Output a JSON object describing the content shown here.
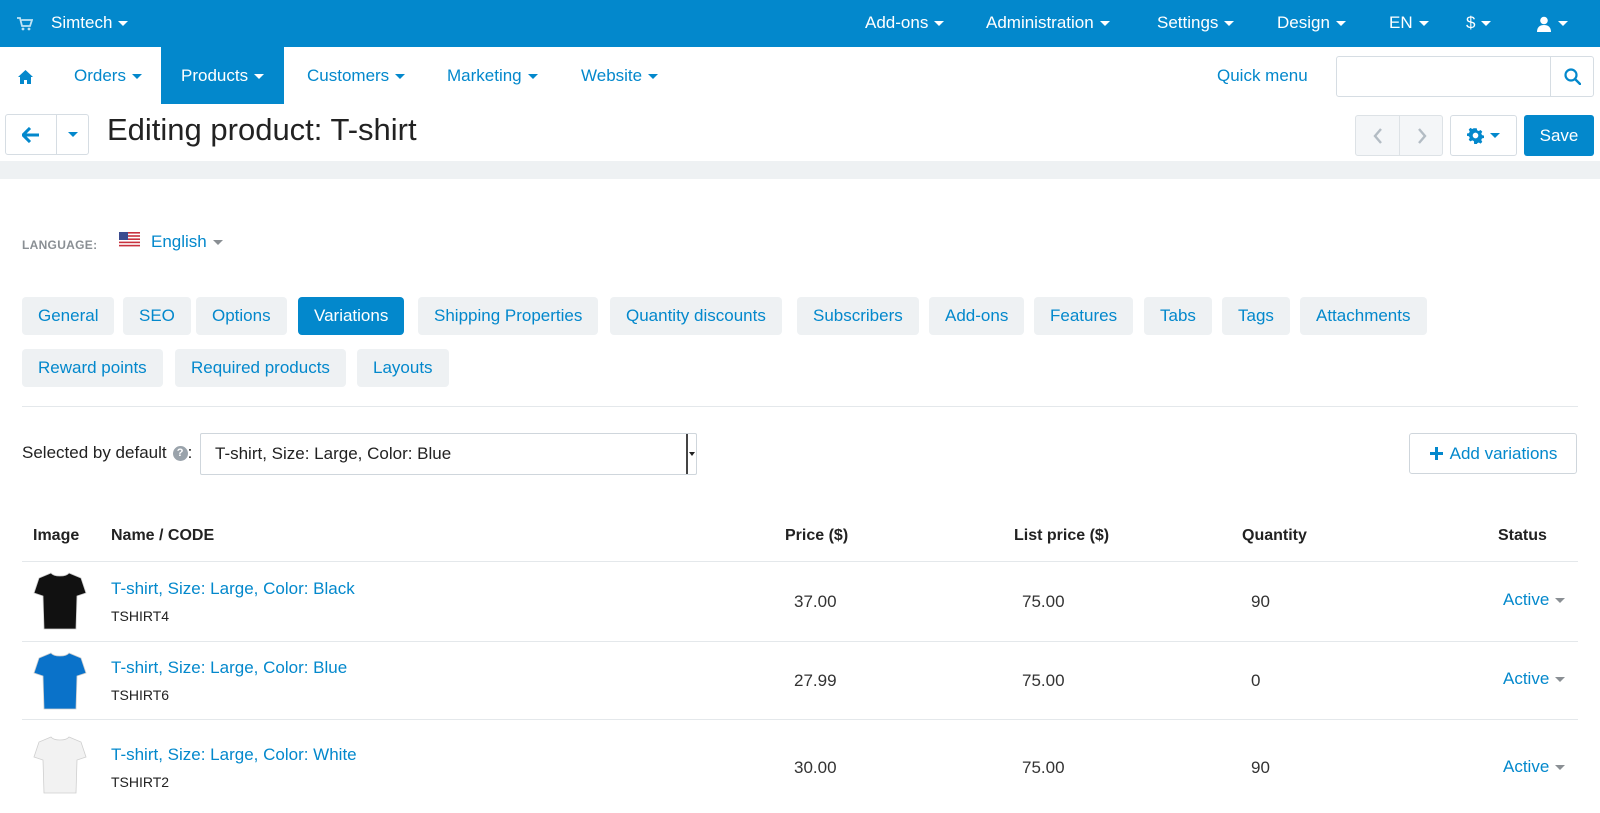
{
  "topbar": {
    "store": "Simtech",
    "menus": [
      "Add-ons",
      "Administration",
      "Settings",
      "Design",
      "EN",
      "$"
    ]
  },
  "nav": {
    "items": [
      "Orders",
      "Products",
      "Customers",
      "Marketing",
      "Website"
    ],
    "active": "Products",
    "quick_menu": "Quick menu",
    "search_placeholder": ""
  },
  "toolbar": {
    "title": "Editing product: T-shirt",
    "save": "Save"
  },
  "language": {
    "label": "LANGUAGE:",
    "value": "English"
  },
  "tabs": [
    "General",
    "SEO",
    "Options",
    "Variations",
    "Shipping Properties",
    "Quantity discounts",
    "Subscribers",
    "Add-ons",
    "Features",
    "Tabs",
    "Tags",
    "Attachments",
    "Reward points",
    "Required products",
    "Layouts"
  ],
  "active_tab": "Variations",
  "variations": {
    "selected_label": "Selected by default",
    "selected_value": "T-shirt, Size: Large, Color: Blue",
    "add_button": "Add variations",
    "columns": [
      "Image",
      "Name / CODE",
      "Price ($)",
      "List price ($)",
      "Quantity",
      "Status"
    ],
    "rows": [
      {
        "name": "T-shirt, Size: Large, Color: Black",
        "code": "TSHIRT4",
        "price": "37.00",
        "list_price": "75.00",
        "quantity": "90",
        "status": "Active",
        "color": "#111111"
      },
      {
        "name": "T-shirt, Size: Large, Color: Blue",
        "code": "TSHIRT6",
        "price": "27.99",
        "list_price": "75.00",
        "quantity": "0",
        "status": "Active",
        "color": "#0a72c9"
      },
      {
        "name": "T-shirt, Size: Large, Color: White",
        "code": "TSHIRT2",
        "price": "30.00",
        "list_price": "75.00",
        "quantity": "90",
        "status": "Active",
        "color": "#f2f2f2"
      }
    ]
  },
  "colors": {
    "accent": "#0388cc",
    "tab_bg": "#eef1f3"
  }
}
